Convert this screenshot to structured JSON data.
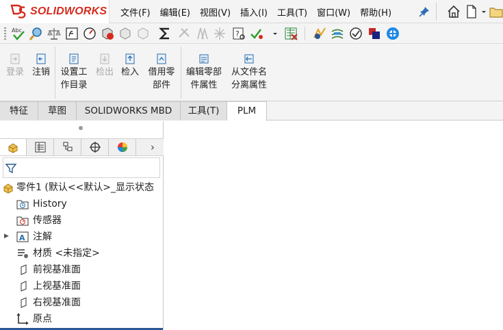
{
  "app": {
    "logo_text": "SOLIDWORKS"
  },
  "menu": [
    {
      "label": "文件(F)"
    },
    {
      "label": "编辑(E)"
    },
    {
      "label": "视图(V)"
    },
    {
      "label": "插入(I)"
    },
    {
      "label": "工具(T)"
    },
    {
      "label": "窗口(W)"
    },
    {
      "label": "帮助(H)"
    }
  ],
  "icons": {
    "pin": "pin-icon",
    "home": "home-icon",
    "new": "new-document-icon",
    "dropdown": "chevron-down-icon"
  },
  "ribbon": {
    "buttons": [
      {
        "line1": "登录",
        "line2": "",
        "enabled": false
      },
      {
        "line1": "注销",
        "line2": "",
        "enabled": true
      },
      {
        "line1": "设置工",
        "line2": "作目录",
        "enabled": true
      },
      {
        "line1": "检出",
        "line2": "",
        "enabled": false
      },
      {
        "line1": "检入",
        "line2": "",
        "enabled": true
      },
      {
        "line1": "借用零",
        "line2": "部件",
        "enabled": true
      },
      {
        "line1": "编辑零部",
        "line2": "件属性",
        "enabled": true
      },
      {
        "line1": "从文件名",
        "line2": "分离属性",
        "enabled": true
      }
    ]
  },
  "tabs": [
    {
      "label": "特征",
      "active": false
    },
    {
      "label": "草图",
      "active": false
    },
    {
      "label": "SOLIDWORKS MBD",
      "active": false
    },
    {
      "label": "工具(T)",
      "active": false
    },
    {
      "label": "PLM",
      "active": true
    }
  ],
  "feature_tree": {
    "root": {
      "label": "零件1  (默认<<默认>_显示状态"
    },
    "items": [
      {
        "label": "History",
        "icon": "history-folder-icon"
      },
      {
        "label": "传感器",
        "icon": "sensor-folder-icon"
      },
      {
        "label": "注解",
        "icon": "annotation-icon",
        "expandable": true
      },
      {
        "label": "材质 <未指定>",
        "icon": "material-icon"
      },
      {
        "label": "前视基准面",
        "icon": "plane-icon"
      },
      {
        "label": "上视基准面",
        "icon": "plane-icon"
      },
      {
        "label": "右视基准面",
        "icon": "plane-icon"
      },
      {
        "label": "原点",
        "icon": "origin-icon"
      }
    ]
  },
  "colors": {
    "brand_red": "#d52b1e",
    "accent_blue": "#2b5797",
    "toolbar_bg": "#f4f4f4"
  }
}
